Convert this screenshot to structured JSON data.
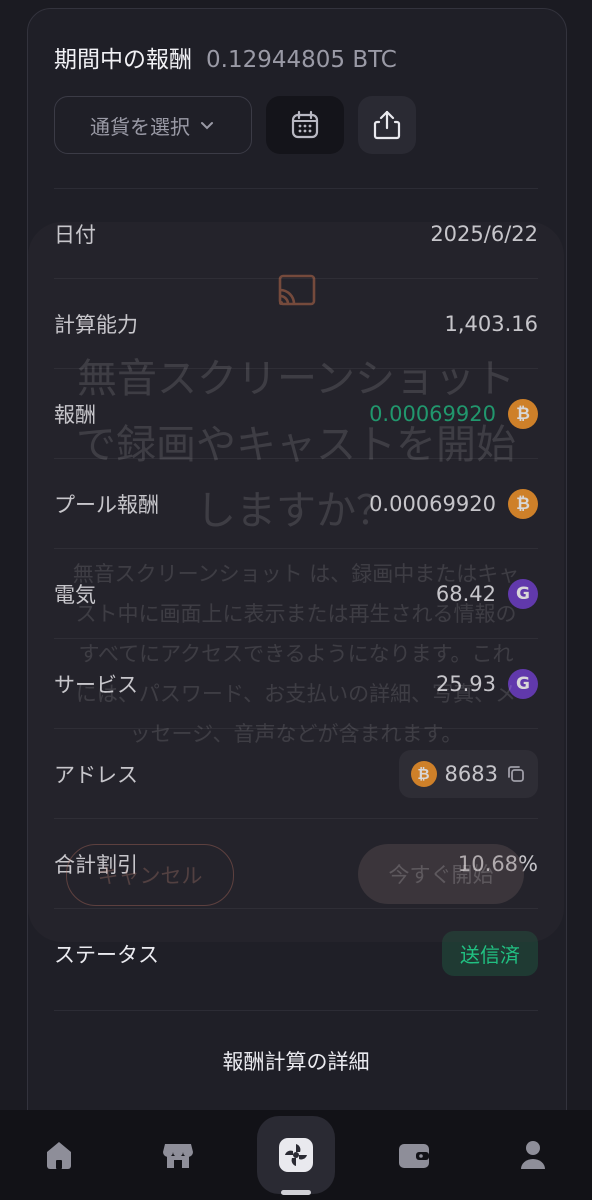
{
  "header": {
    "title": "期間中の報酬",
    "total": "0.12944805 BTC"
  },
  "toolbar": {
    "currency_select": "通貨を選択"
  },
  "rows": {
    "date": {
      "label": "日付",
      "value": "2025/6/22"
    },
    "hashrate": {
      "label": "計算能力",
      "value": "1,403.16"
    },
    "reward": {
      "label": "報酬",
      "value": "0.00069920"
    },
    "pool_reward": {
      "label": "プール報酬",
      "value": "0.00069920"
    },
    "electricity": {
      "label": "電気",
      "value": "68.42"
    },
    "service": {
      "label": "サービス",
      "value": "25.93"
    },
    "address": {
      "label": "アドレス",
      "value": "8683"
    },
    "discount": {
      "label": "合計割引",
      "value": "10.68%"
    },
    "status": {
      "label": "ステータス",
      "value": "送信済"
    }
  },
  "details_link": "報酬計算の詳細",
  "overlay": {
    "title": "無音スクリーンショットで録画やキャストを開始しますか？",
    "body": "無音スクリーンショット は、録画中またはキャスト中に画面上に表示または再生される情報のすべてにアクセスできるようになります。これには、パスワード、お支払いの詳細、写真、メッセージ、音声などが含まれます。",
    "cancel": "キャンセル",
    "start": "今すぐ開始"
  },
  "colors": {
    "accent_green": "#1bb07a",
    "btc_orange": "#f39325",
    "token_purple": "#6b3ac9"
  },
  "nav": [
    "home-icon",
    "store-icon",
    "fan-icon",
    "wallet-icon",
    "profile-icon"
  ]
}
